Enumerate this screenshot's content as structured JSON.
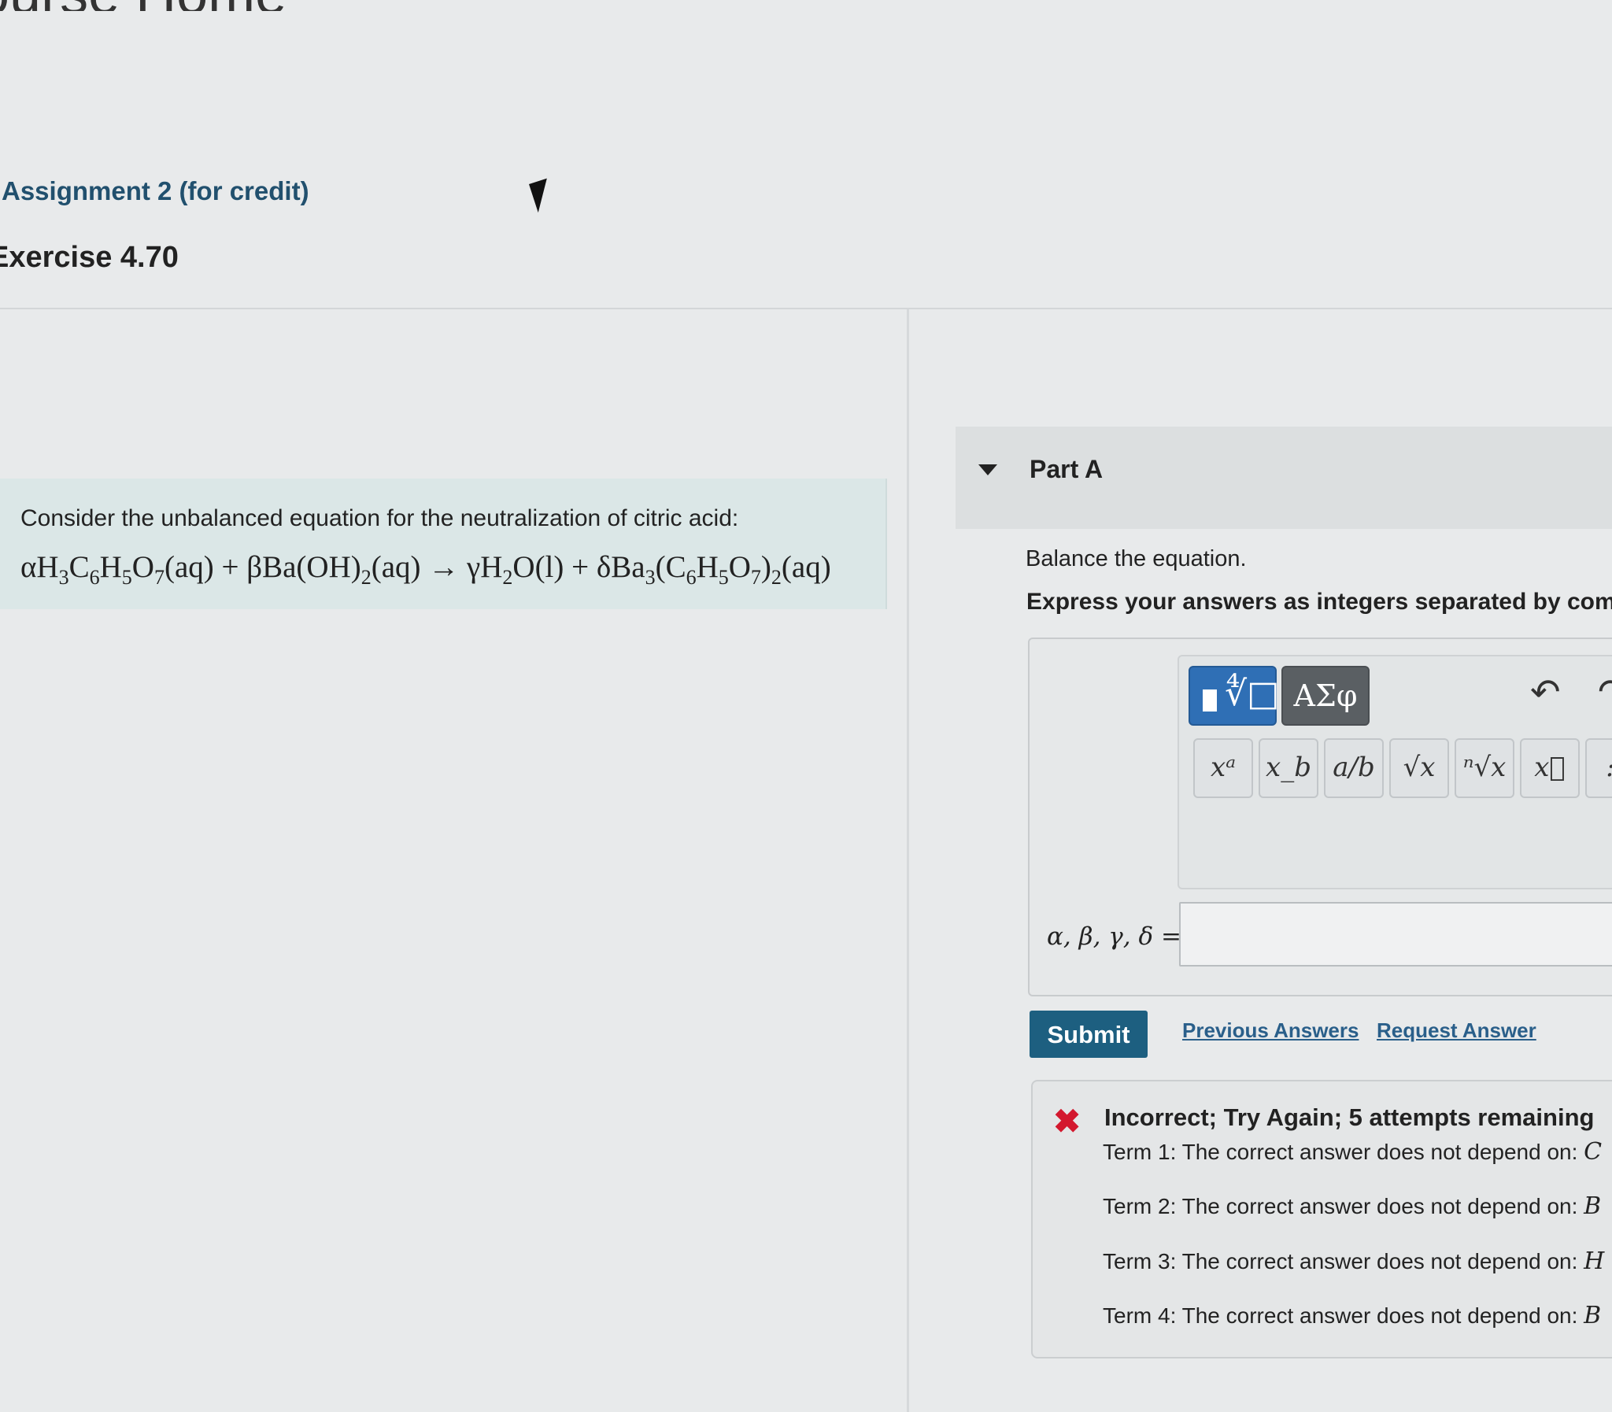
{
  "page": {
    "heading_partial": "ourse Home"
  },
  "breadcrumb": {
    "assignment": "Assignment 2 (for credit)"
  },
  "exercise": {
    "title": "Exercise 4.70"
  },
  "problem": {
    "intro": "Consider the unbalanced equation for the neutralization of citric acid:",
    "equation": {
      "t1": "αH",
      "t1s1": "3",
      "t2": "C",
      "t2s1": "6",
      "t3": "H",
      "t3s1": "5",
      "t4": "O",
      "t4s1": "7",
      "t5": "(aq) + βBa(OH)",
      "t5s1": "2",
      "t6": "(aq) → γH",
      "t6s1": "2",
      "t7": "O(l) + δBa",
      "t7s1": "3",
      "t8": "(C",
      "t8s1": "6",
      "t9": "H",
      "t9s1": "5",
      "t10": "O",
      "t10s1": "7",
      "t11": ")",
      "t11s1": "2",
      "t12": "(aq)"
    }
  },
  "part": {
    "title": "Part A",
    "instruction": "Balance the equation.",
    "format_hint": "Express your answers as integers separated by comma"
  },
  "toolbar": {
    "greek_label": "ΑΣφ",
    "buttons": [
      "xᵃ",
      "x_b",
      "a/b",
      "√x",
      "ⁿ√x",
      "x⃗",
      ":"
    ]
  },
  "answer": {
    "variables_label": "α, β, γ, δ =",
    "value": ""
  },
  "actions": {
    "submit": "Submit",
    "previous_answers": "Previous Answers",
    "request_answer": "Request Answer"
  },
  "feedback": {
    "status": "Incorrect; Try Again; 5 attempts remaining",
    "terms": [
      {
        "prefix": "Term 1: The correct answer does not depend on: ",
        "tail": "C"
      },
      {
        "prefix": "Term 2: The correct answer does not depend on: ",
        "tail": "B"
      },
      {
        "prefix": "Term 3: The correct answer does not depend on: ",
        "tail": "H"
      },
      {
        "prefix": "Term 4: The correct answer does not depend on: ",
        "tail": "B"
      }
    ]
  },
  "colors": {
    "accent": "#1d5f80",
    "link": "#2a5f8a",
    "error": "#d3182e",
    "problem_bg": "#dbe7e7",
    "templates_btn": "#2f6fb5"
  }
}
